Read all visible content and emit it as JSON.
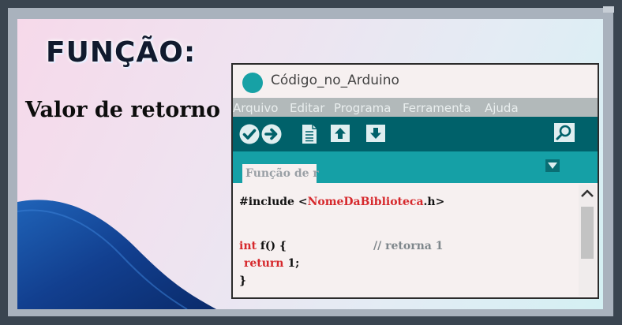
{
  "slide": {
    "title": "FUNÇÃO:",
    "subtitle": "Valor de retorno"
  },
  "ide": {
    "window_title": "Código_no_Arduino",
    "menu": [
      "Arquivo",
      "Editar",
      "Programa",
      "Ferramenta",
      "Ajuda"
    ],
    "toolbar": [
      "verify-icon",
      "upload-icon",
      "new-file-icon",
      "open-icon",
      "save-icon",
      "serial-monitor-icon"
    ],
    "tab_label": "Função de r",
    "code": {
      "include_kw": "#include",
      "include_open": "<",
      "include_lib": "NomeDaBiblioteca",
      "include_close": ".h>",
      "decl_type": "int",
      "decl_rest": "f() {",
      "comment": "// retorna 1",
      "return_kw": "return",
      "return_val": "1;",
      "close_brace": "}"
    },
    "colors": {
      "accent": "#17a1a5",
      "toolbar": "#00616a",
      "keyword": "#d6282c"
    }
  }
}
